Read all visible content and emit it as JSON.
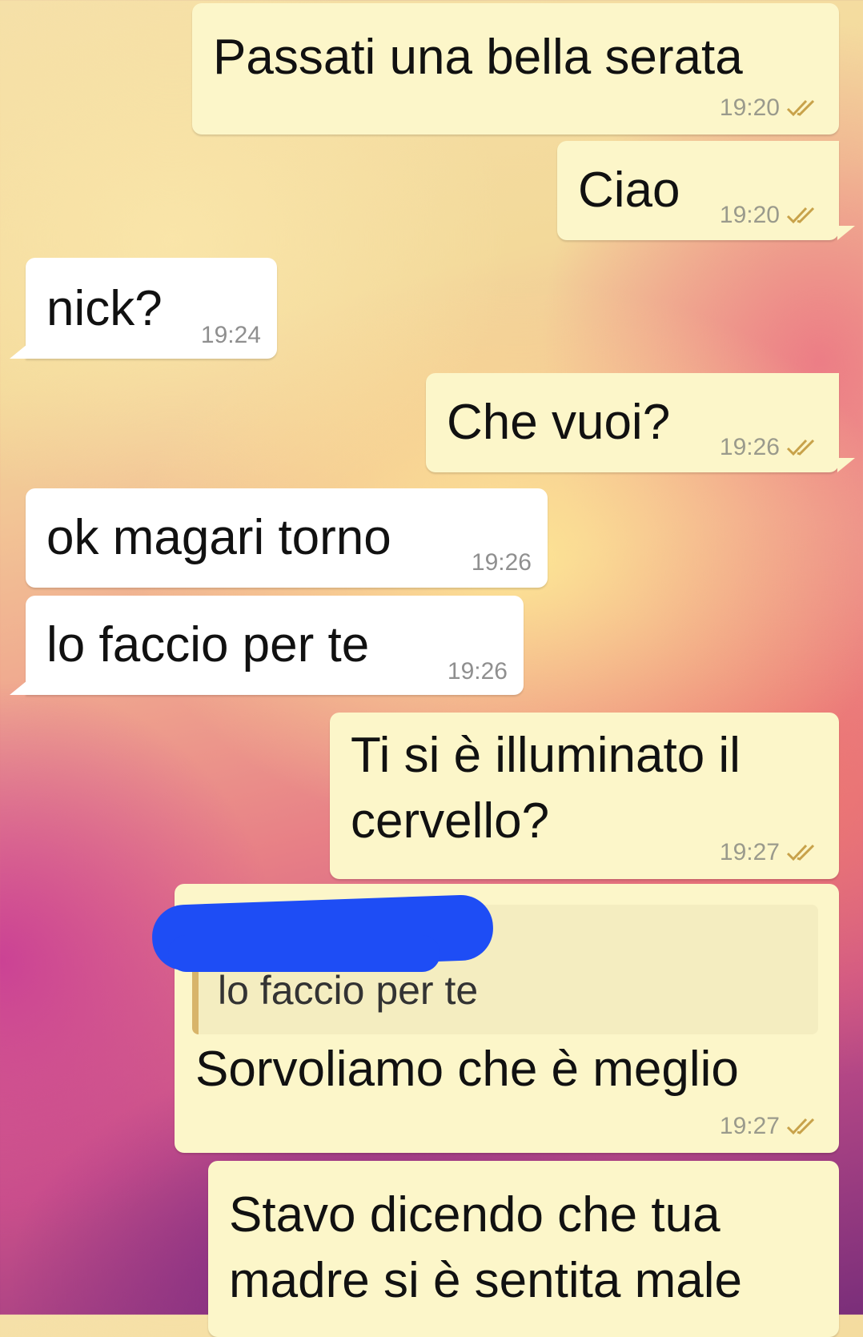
{
  "messages": [
    {
      "id": "m1",
      "direction": "outgoing",
      "text": "Passati una bella serata",
      "time": "19:20",
      "status": "read"
    },
    {
      "id": "m2",
      "direction": "outgoing",
      "text": "Ciao",
      "time": "19:20",
      "status": "read"
    },
    {
      "id": "m3",
      "direction": "incoming",
      "text": "nick?",
      "time": "19:24"
    },
    {
      "id": "m4",
      "direction": "outgoing",
      "text": "Che vuoi?",
      "time": "19:26",
      "status": "read"
    },
    {
      "id": "m5",
      "direction": "incoming",
      "text": "ok magari torno",
      "time": "19:26"
    },
    {
      "id": "m6",
      "direction": "incoming",
      "text": "lo faccio per te",
      "time": "19:26"
    },
    {
      "id": "m7",
      "direction": "outgoing",
      "lines": [
        "Ti si è illuminato il",
        "cervello?"
      ],
      "time": "19:27",
      "status": "read"
    },
    {
      "id": "m8",
      "direction": "outgoing",
      "quote": {
        "author": "[redacted]",
        "text": "lo faccio per te"
      },
      "text": "Sorvoliamo che è meglio",
      "time": "19:27",
      "status": "read"
    },
    {
      "id": "m9",
      "direction": "outgoing",
      "lines": [
        "Stavo dicendo che tua",
        "madre si è sentita male"
      ]
    }
  ],
  "colors": {
    "outgoing_bubble": "#fcf6c9",
    "incoming_bubble": "#ffffff",
    "quote_bar": "#d8b46a",
    "redaction": "#1e4df5",
    "read_ticks": "#c8a24a"
  },
  "icons": {
    "read_receipt": "double-check-icon"
  }
}
